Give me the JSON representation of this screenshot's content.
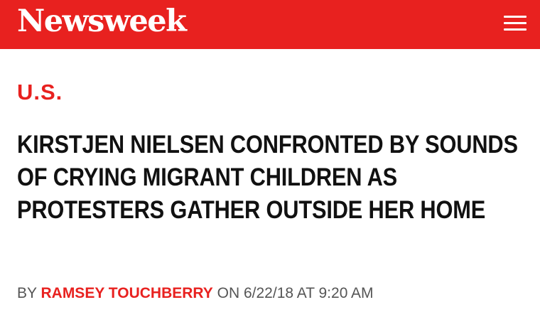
{
  "header": {
    "logo_text": "Newsweek",
    "menu_icon": "hamburger-menu-icon"
  },
  "article": {
    "section": "U.S.",
    "headline": "KIRSTJEN NIELSEN CONFRONTED BY SOUNDS OF CRYING MIGRANT CHILDREN AS PROTESTERS GATHER OUTSIDE HER HOME",
    "byline": {
      "prefix": "BY",
      "author": "RAMSEY TOUCHBERRY",
      "on_label": "ON",
      "date": "6/22/18",
      "at_label": "AT",
      "time": "9:20 AM"
    }
  },
  "colors": {
    "brand_red": "#e8211f",
    "headline_text": "#111111",
    "byline_text": "#555555"
  }
}
